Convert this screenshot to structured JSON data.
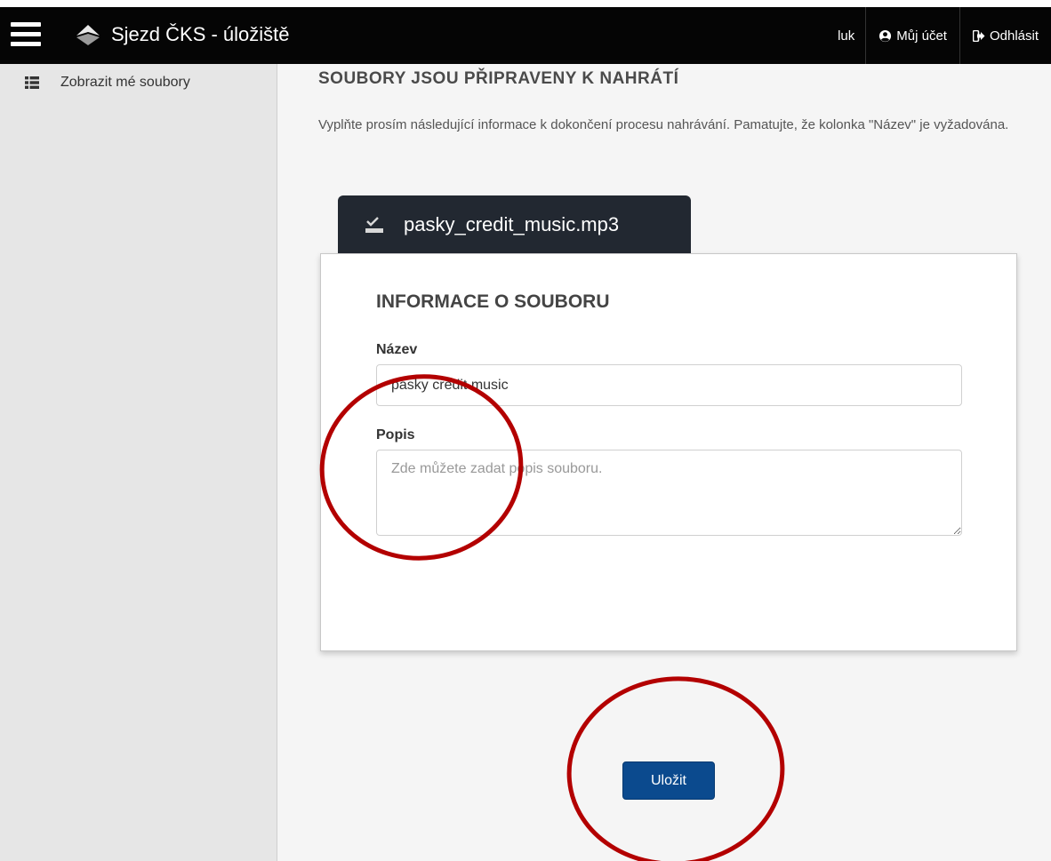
{
  "header": {
    "menu_icon": "hamburger-icon",
    "logo_icon": "app-logo-icon",
    "title": "Sjezd ČKS - úložiště",
    "user": "luk",
    "account_label": "Můj účet",
    "account_icon": "user-circle-icon",
    "logout_label": "Odhlásit",
    "logout_icon": "sign-out-icon"
  },
  "sidebar": {
    "items": [
      {
        "label": "Zobrazit mé soubory",
        "icon": "list-icon"
      }
    ]
  },
  "main": {
    "title": "SOUBORY JSOU PŘIPRAVENY K NAHRÁTÍ",
    "intro": "Vyplňte prosím následující informace k dokončení procesu nahrávání. Pamatujte, že kolonka \"Název\" je vyžadována.",
    "file": {
      "name": "pasky_credit_music.mp3",
      "icon": "upload-done-icon"
    },
    "form": {
      "title": "INFORMACE O SOUBORU",
      "name_label": "Název",
      "name_value": "pasky credit music",
      "description_label": "Popis",
      "description_placeholder": "Zde můžete zadat popis souboru."
    },
    "save_label": "Uložit"
  },
  "colors": {
    "topbar": "#050505",
    "sidebar": "#e6e6e6",
    "accent": "#0b4a8e",
    "annotation": "#b30000"
  }
}
